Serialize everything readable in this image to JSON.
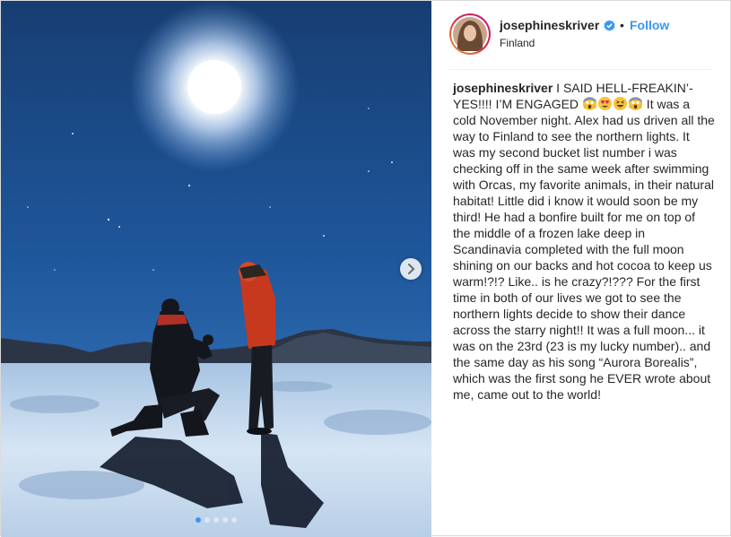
{
  "post": {
    "username": "josephineskriver",
    "follow_label": "Follow",
    "bullet": "•",
    "location": "Finland",
    "verified_icon": "verified-badge-icon",
    "carousel": {
      "slide_count": 5,
      "active_index": 0,
      "next_icon": "chevron-right-icon"
    },
    "caption": {
      "username": "josephineskriver",
      "text_before_emoji": " I SAID HELL-FREAKIN’-YES!!!! I’M ENGAGED ",
      "emojis": [
        "screaming-face-emoji",
        "heart-eyes-emoji",
        "grinning-squinting-emoji",
        "screaming-face-emoji"
      ],
      "text_after_emoji": " It was a cold November night. Alex had us driven all the way to Finland to see the northern lights. It was my second bucket list number i was checking off in the same week after swimming with Orcas, my favorite animals, in their natural habitat! Little did i know it would soon be my third! He had a bonfire built for me on top of the middle of a frozen lake deep in Scandinavia completed with the full moon shining on our backs and hot cocoa to keep us warm!?!? Like.. is he crazy?!??? For the first time in both of our lives we got to see the northern lights decide to show their dance across the starry night!! It was a full moon... it was on the 23rd (23 is my lucky number).. and the same day as his song “Aurora Borealis”, which was the first song he EVER wrote about me, came out to the world!"
    }
  },
  "colors": {
    "link": "#3897f0",
    "text": "#262626",
    "border": "#dbdbdb"
  }
}
